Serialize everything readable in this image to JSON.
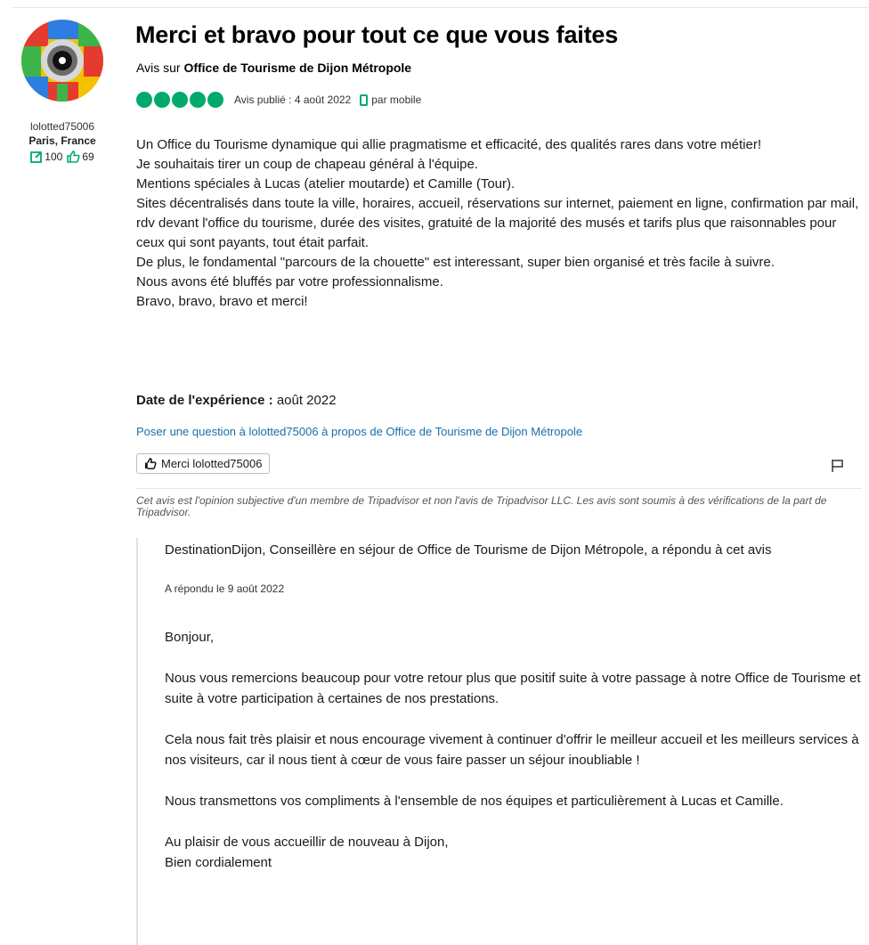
{
  "reviewer": {
    "username": "lolotted75006",
    "location": "Paris, France",
    "contributions": "100",
    "helpful_votes": "69"
  },
  "review": {
    "title": "Merci et bravo pour tout ce que vous faites",
    "subject_prefix": "Avis sur",
    "subject_name": "Office de Tourisme de Dijon Métropole",
    "rating": 5,
    "published": "Avis publié : 4 août 2022",
    "via": "par mobile",
    "body": [
      "Un Office du Tourisme dynamique qui allie pragmatisme et efficacité, des qualités rares dans votre métier!",
      "Je souhaitais tirer un coup de chapeau général à l'équipe.",
      "Mentions spéciales à Lucas (atelier moutarde) et Camille (Tour).",
      "Sites décentralisés dans toute la ville, horaires, accueil, réservations sur internet, paiement en ligne, confirmation par mail, rdv devant l'office du tourisme, durée des visites, gratuité de la majorité des musés et tarifs plus que raisonnables pour ceux qui sont payants, tout était parfait.",
      "De plus, le fondamental \"parcours de la chouette\" est interessant, super bien organisé et très facile à suivre.",
      "Nous avons été bluffés par votre professionnalisme.",
      "Bravo, bravo, bravo et merci!"
    ],
    "experience_label": "Date de l'expérience :",
    "experience_value": "août 2022",
    "ask_link": "Poser une question à lolotted75006 à propos de Office de Tourisme de Dijon Métropole",
    "thanks_button": "Merci lolotted75006",
    "disclaimer": "Cet avis est l'opinion subjective d'un membre de Tripadvisor et non l'avis de Tripadvisor LLC. Les avis sont soumis à des vérifications de la part de Tripadvisor."
  },
  "response": {
    "header": "DestinationDijon, Conseillère en séjour de Office de Tourisme de Dijon Métropole, a répondu à cet avis",
    "date": "A répondu le 9 août 2022",
    "paragraphs": [
      "Bonjour,",
      "Nous vous remercions beaucoup pour votre retour plus que positif suite à votre passage à notre Office de Tourisme et suite à votre participation à certaines de nos prestations.",
      "Cela nous fait très plaisir et nous encourage vivement à continuer d'offrir le meilleur accueil et les meilleurs services à nos visiteurs, car il nous tient à cœur de vous faire passer un séjour inoubliable !",
      "Nous transmettons vos compliments à l'ensemble de nos équipes et particulièrement à Lucas et Camille."
    ],
    "closing": [
      "Au plaisir de vous accueillir de nouveau à Dijon,",
      "Bien cordialement"
    ]
  },
  "colors": {
    "accent_green": "#00aa6c",
    "link_blue": "#1a6ea8"
  },
  "icons": [
    "avatar",
    "edit-icon",
    "thumbs-up-icon",
    "mobile-icon",
    "flag-icon"
  ]
}
